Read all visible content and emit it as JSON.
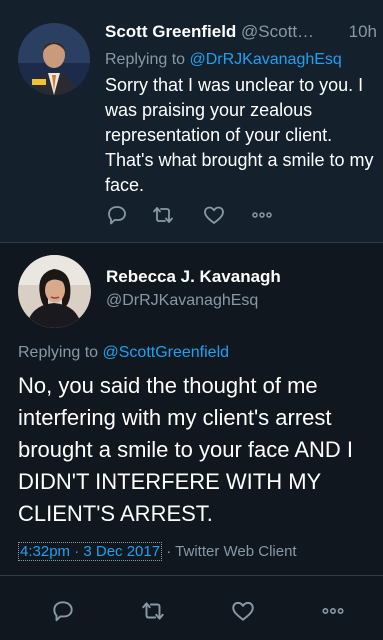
{
  "tweet1": {
    "author_name": "Scott Greenfield",
    "handle": "@Scott…",
    "time": "10h",
    "replying_prefix": "Replying to ",
    "replying_handle": "@DrRJKavanaghEsq",
    "text": "Sorry that I was unclear to you. I was praising your zealous representation of your client. That's what brought a smile to my face.",
    "actions": [
      "reply-icon",
      "retweet-icon",
      "like-icon",
      "more-icon"
    ]
  },
  "tweet2": {
    "author_name": "Rebecca J. Kavanagh",
    "handle": "@DrRJKavanaghEsq",
    "replying_prefix": "Replying to ",
    "replying_handle": "@ScottGreenfield",
    "text": "No, you said the thought of me interfering with my client's arrest brought a smile to your face AND I DIDN'T INTERFERE WITH MY CLIENT'S ARREST.",
    "timestamp": "4:32pm · 3 Dec 2017",
    "source_separator": " · ",
    "source": "Twitter Web Client",
    "actions": [
      "reply-icon",
      "retweet-icon",
      "like-icon",
      "more-icon"
    ]
  },
  "colors": {
    "background": "#10171e",
    "muted": "#8899a6",
    "link": "#1da1f2",
    "divider": "#2f3c48"
  }
}
